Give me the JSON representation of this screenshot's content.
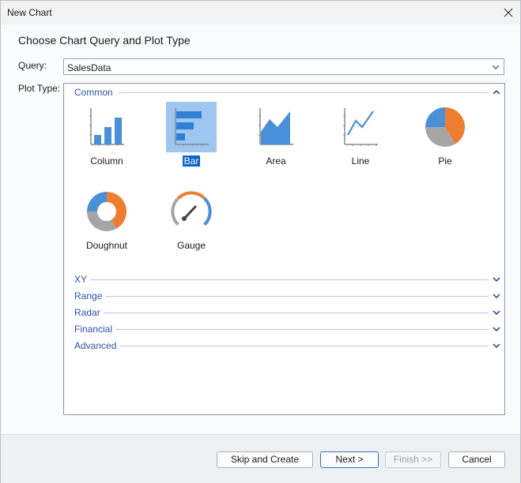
{
  "window": {
    "title": "New Chart"
  },
  "header": {
    "text": "Choose Chart Query and Plot Type"
  },
  "query": {
    "label": "Query:",
    "value": "SalesData"
  },
  "plot_type": {
    "label": "Plot Type:"
  },
  "groups": {
    "common": {
      "label": "Common",
      "expanded": true
    },
    "xy": {
      "label": "XY",
      "expanded": false
    },
    "range": {
      "label": "Range",
      "expanded": false
    },
    "radar": {
      "label": "Radar",
      "expanded": false
    },
    "financial": {
      "label": "Financial",
      "expanded": false
    },
    "advanced": {
      "label": "Advanced",
      "expanded": false
    }
  },
  "chart_types": [
    {
      "id": "column",
      "label": "Column",
      "icon": "column-chart-icon",
      "selected": false
    },
    {
      "id": "bar",
      "label": "Bar",
      "icon": "bar-chart-icon",
      "selected": true
    },
    {
      "id": "area",
      "label": "Area",
      "icon": "area-chart-icon",
      "selected": false
    },
    {
      "id": "line",
      "label": "Line",
      "icon": "line-chart-icon",
      "selected": false
    },
    {
      "id": "pie",
      "label": "Pie",
      "icon": "pie-chart-icon",
      "selected": false
    },
    {
      "id": "doughnut",
      "label": "Doughnut",
      "icon": "doughnut-chart-icon",
      "selected": false
    },
    {
      "id": "gauge",
      "label": "Gauge",
      "icon": "gauge-chart-icon",
      "selected": false
    }
  ],
  "buttons": {
    "skip": "Skip and Create",
    "next": "Next >",
    "finish": "Finish >>",
    "cancel": "Cancel"
  },
  "colors": {
    "accent_blue": "#4a90d9",
    "accent_orange": "#ee7d31",
    "accent_gray": "#a5a5a5",
    "selection": "#9fc6ee",
    "group_header": "#2e52a8"
  }
}
